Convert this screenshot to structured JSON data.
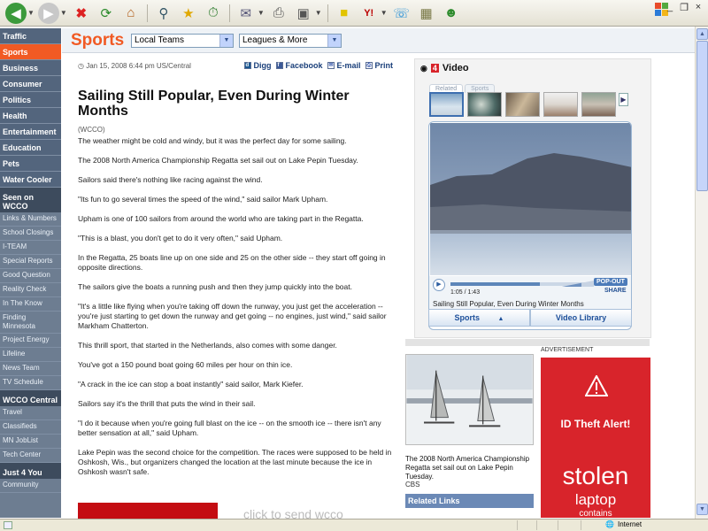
{
  "browser": {
    "window_controls": [
      "_",
      "❐",
      "×"
    ]
  },
  "sidebar": {
    "main_items": [
      {
        "label": "Traffic",
        "active": false
      },
      {
        "label": "Sports",
        "active": true
      },
      {
        "label": "Business",
        "active": false
      },
      {
        "label": "Consumer",
        "active": false
      },
      {
        "label": "Politics",
        "active": false
      },
      {
        "label": "Health",
        "active": false
      },
      {
        "label": "Entertainment",
        "active": false
      },
      {
        "label": "Education",
        "active": false
      },
      {
        "label": "Pets",
        "active": false
      },
      {
        "label": "Water Cooler",
        "active": false
      }
    ],
    "seen_heading": "Seen on WCCO",
    "seen_items": [
      "Links & Numbers",
      "School Closings",
      "I-TEAM",
      "Special Reports",
      "Good Question",
      "Reality Check",
      "In The Know",
      "Finding Minnesota",
      "Project Energy",
      "Lifeline",
      "News Team",
      "TV Schedule"
    ],
    "central_heading": "WCCO Central",
    "central_items": [
      "Travel",
      "Classifieds",
      "MN JobList",
      "Tech Center"
    ],
    "just4you_heading": "Just 4 You",
    "just4you_items": [
      "Community"
    ]
  },
  "sportsbar": {
    "title": "Sports",
    "select1": "Local Teams",
    "select2": "Leagues & More"
  },
  "article": {
    "timestamp": "Jan 15, 2008 6:44 pm US/Central",
    "share": {
      "digg": "Digg",
      "facebook": "Facebook",
      "email": "E-mail",
      "print": "Print"
    },
    "headline": "Sailing Still Popular, Even During Winter Months",
    "dateline": "(WCCO)",
    "paragraphs": [
      "The weather might be cold and windy, but it was the perfect day for some sailing.",
      "The 2008 North America Championship Regatta set sail out on Lake Pepin Tuesday.",
      "Sailors said there's nothing like racing against the wind.",
      "\"Its fun to go several times the speed of the wind,\" said sailor Mark Upham.",
      "Upham is one of 100 sailors from around the world who are taking part in the Regatta.",
      "\"This is a blast, you don't get to do it very often,\" said Upham.",
      "In the Regatta, 25 boats line up on one side and 25 on the other side -- they start off going in opposite directions.",
      "The sailors give the boats a running push and then they jump quickly into the boat.",
      "\"It's a little like flying when you're taking off down the runway, you just get the acceleration -- you're just starting to get down the runway and get going -- no engines, just wind,\" said sailor Markham Chatterton.",
      "This thrill sport, that started in the Netherlands, also comes with some danger.",
      "You've got a 150 pound boat going 60 miles per hour on thin ice.",
      "\"A crack in the ice can stop a boat instantly\" said sailor, Mark Kiefer.",
      "Sailors say it's the thrill that puts the wind in their sail.",
      "\"I do it because when you're going full blast on the ice -- on the smooth ice -- there isn't any better sensation at all,\" said Upham.",
      "Lake Pepin was the second choice for the competition. The races were supposed to be held in Oshkosh, Wis., but organizers changed the location at the last minute because the ice in Oshkosh wasn't safe."
    ],
    "click_text": "click to send wcco"
  },
  "video": {
    "title": "Video",
    "tabs": [
      "Related",
      "Sports"
    ],
    "time": "1:05 / 1:43",
    "progress_fraction": 0.63,
    "popout": "POP-OUT",
    "share": "SHARE",
    "caption": "Sailing Still Popular, Even During Winter Months",
    "btn_sports": "Sports",
    "btn_library": "Video Library"
  },
  "photo": {
    "caption": "The 2008 North America Championship Regatta set sail out on Lake Pepin Tuesday.",
    "credit": "CBS",
    "related_links": "Related Links"
  },
  "ad": {
    "label": "ADVERTISEMENT",
    "alert": "ID Theft Alert!",
    "line1": "stolen",
    "line2": "laptop",
    "line3": "contains"
  },
  "status": {
    "zone": "Internet"
  },
  "colors": {
    "accent_orange": "#f15a24",
    "nav_blue": "#53657d",
    "ad_red": "#d8242b"
  }
}
